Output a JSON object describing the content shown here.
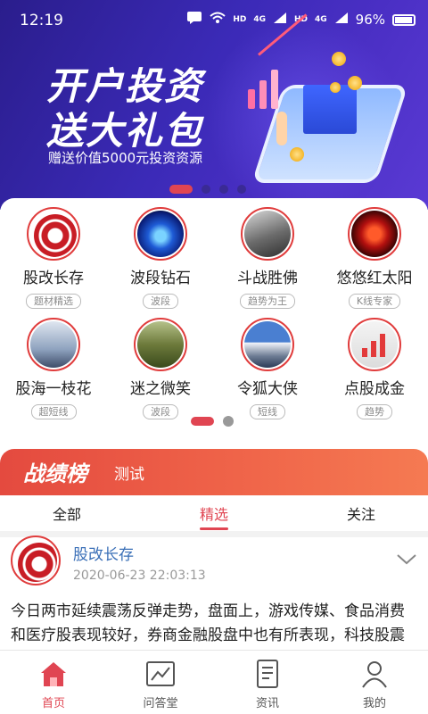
{
  "status_bar": {
    "time": "12:19",
    "net1": "HD",
    "net2": "4G",
    "net3": "HD",
    "net4": "4G",
    "battery": "96%"
  },
  "banner": {
    "title_line1": "开户投资",
    "title_line2": "送大礼包",
    "subtitle": "赠送价值5000元投资资源",
    "pages": 4,
    "active_page": 1
  },
  "experts": [
    {
      "name": "股改长存",
      "tag": "题材精选",
      "avatar": "logo-avatar"
    },
    {
      "name": "波段钻石",
      "tag": "波段",
      "avatar": "diamond-avatar"
    },
    {
      "name": "斗战胜佛",
      "tag": "趋势为王",
      "avatar": "warrior-avatar"
    },
    {
      "name": "悠悠红太阳",
      "tag": "K线专家",
      "avatar": "red-sun-avatar"
    },
    {
      "name": "股海一枝花",
      "tag": "超短线",
      "avatar": "lady-avatar"
    },
    {
      "name": "迷之微笑",
      "tag": "波段",
      "avatar": "tree-avatar"
    },
    {
      "name": "令狐大侠",
      "tag": "短线",
      "avatar": "mountain-avatar"
    },
    {
      "name": "点股成金",
      "tag": "趋势",
      "avatar": "bull-avatar"
    }
  ],
  "experts_pager": {
    "pages": 2,
    "active_page": 1
  },
  "ranking": {
    "title": "战绩榜",
    "subtitle": "测试"
  },
  "tabs": [
    {
      "label": "全部"
    },
    {
      "label": "精选"
    },
    {
      "label": "关注"
    }
  ],
  "active_tab": 1,
  "post": {
    "author": "股改长存",
    "time": "2020-06-23 22:03:13",
    "text": "今日两市延续震荡反弹走势，盘面上，游戏传媒、食品消费和医疗股表现较好，券商金融股盘中也有所表现，科技股震荡分化，农业股调整居前，市场整体还"
  },
  "bottom_nav": [
    {
      "label": "首页",
      "icon": "home-icon"
    },
    {
      "label": "问答堂",
      "icon": "chart-trend-icon"
    },
    {
      "label": "资讯",
      "icon": "news-icon"
    },
    {
      "label": "我的",
      "icon": "user-icon"
    }
  ],
  "colors": {
    "accent": "#e04552",
    "banner_bg": "#3b2ab7",
    "author_link": "#3a6fb7"
  }
}
